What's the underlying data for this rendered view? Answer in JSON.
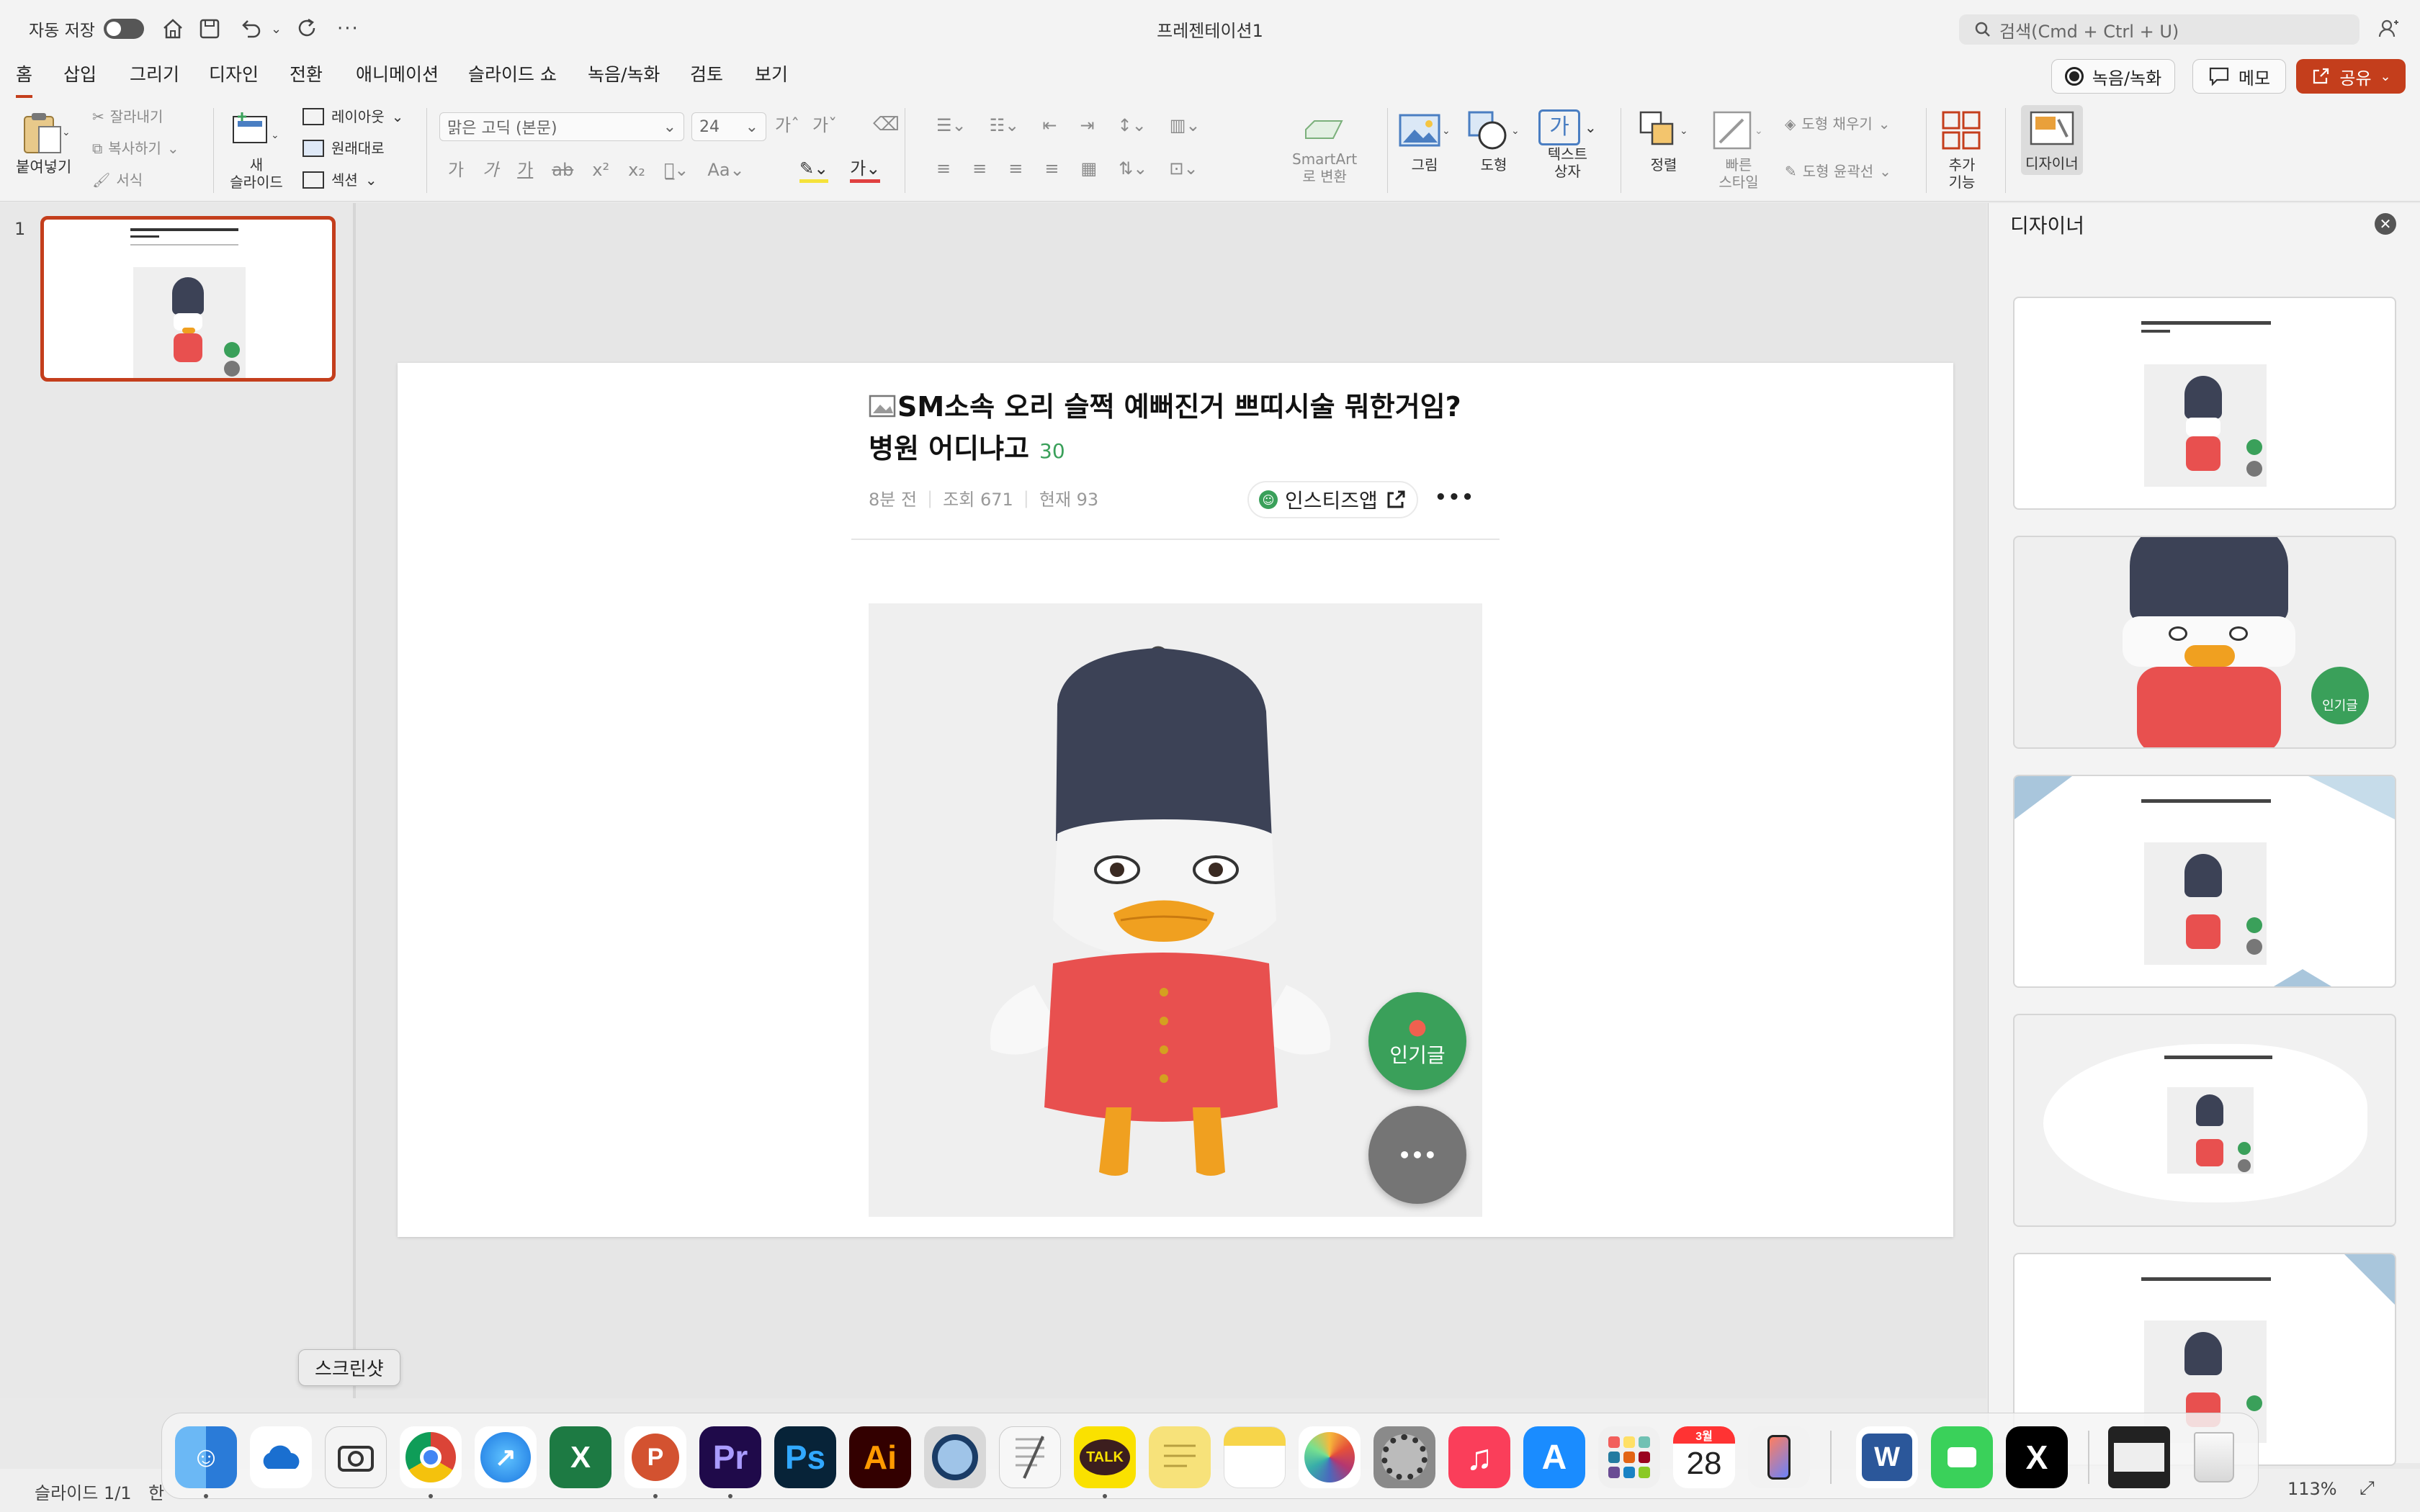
{
  "titlebar": {
    "autosave_label": "자동 저장",
    "doc_title": "프레젠테이션1",
    "search_placeholder": "검색(Cmd + Ctrl + U)"
  },
  "tabs": [
    "홈",
    "삽입",
    "그리기",
    "디자인",
    "전환",
    "애니메이션",
    "슬라이드 쇼",
    "녹음/녹화",
    "검토",
    "보기"
  ],
  "top_buttons": {
    "record": "녹음/녹화",
    "memo": "메모",
    "share": "공유"
  },
  "ribbon": {
    "paste": "붙여넣기",
    "cut": "잘라내기",
    "copy": "복사하기",
    "format": "서식",
    "new_slide_line1": "새",
    "new_slide_line2": "슬라이드",
    "layout": "레이아웃",
    "reset": "원래대로",
    "section": "섹션",
    "font_name": "맑은 고딕 (본문)",
    "font_size": "24",
    "smartart_line1": "SmartArt",
    "smartart_line2": "로 변환",
    "picture": "그림",
    "shape": "도형",
    "textbox_line1": "텍스트",
    "textbox_line2": "상자",
    "arrange": "정렬",
    "quick_style_line1": "빠른",
    "quick_style_line2": "스타일",
    "shape_fill": "도형 채우기",
    "shape_outline": "도형 윤곽선",
    "addins_line1": "추가",
    "addins_line2": "기능",
    "designer": "디자이너",
    "textbox_glyph": "가"
  },
  "thumbnail": {
    "number": "1"
  },
  "slide": {
    "post_title": "SM소속 오리 슬쩍 예뻐진거 쁘띠시술 뭐한거임? 병원 어디냐고",
    "comment_count": "30",
    "meta_time": "8분 전",
    "meta_views": "조회 671",
    "meta_current": "현재 93",
    "app_button": "인스티즈앱",
    "popular_label": "인기글",
    "more_glyph": "•••"
  },
  "designer_panel": {
    "title": "디자이너",
    "popular_label": "인기글"
  },
  "tooltip": "스크린샷",
  "dock": {
    "apps": [
      "Finder",
      "OneDrive",
      "Screenshot",
      "Chrome",
      "Safari",
      "Excel",
      "PowerPoint",
      "Premiere Pro",
      "Photoshop",
      "Illustrator",
      "QuickTime",
      "TextEdit",
      "KakaoTalk",
      "Stickies",
      "Notes",
      "Photos",
      "System Settings",
      "Music",
      "App Store",
      "Launchpad",
      "Calendar",
      "iPhone Mirroring",
      "Word",
      "FaceTime",
      "X",
      "Downloads",
      "Trash"
    ],
    "labels": {
      "premiere": "Pr",
      "photoshop": "Ps",
      "illustrator": "Ai",
      "talk": "TALK",
      "excel": "X",
      "ppt": "P",
      "word": "W",
      "x": "X",
      "calendar_month": "3월",
      "calendar_day": "28"
    }
  },
  "statusbar": {
    "slide_counter": "슬라이드 1/1",
    "lang": "한",
    "zoom": "113%"
  },
  "colors": {
    "accent": "#c43e1c",
    "green": "#3aa05a",
    "duck_hat": "#3c4256",
    "duck_body": "#e8504f",
    "duck_beak": "#f0a020"
  }
}
